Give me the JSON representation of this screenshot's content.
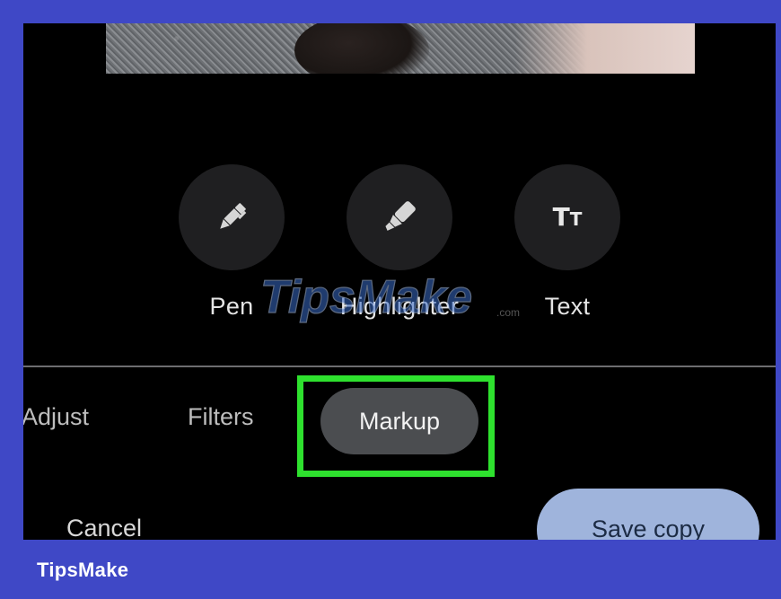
{
  "tools": [
    {
      "label": "Pen",
      "icon": "pen-icon"
    },
    {
      "label": "Highlighter",
      "icon": "highlighter-icon"
    },
    {
      "label": "Text",
      "icon": "text-icon",
      "glyph_big": "T",
      "glyph_small": "T"
    }
  ],
  "tabs": {
    "adjust": "Adjust",
    "filters": "Filters",
    "markup": "Markup",
    "selected": "Markup"
  },
  "actions": {
    "cancel": "Cancel",
    "save": "Save copy"
  },
  "watermark": {
    "text": "TipsMake",
    "suffix": ".com"
  },
  "footer": {
    "brand": "TipsMake"
  },
  "colors": {
    "frame": "#3f48c6",
    "highlight": "#2ee12e",
    "save_button": "#9fb4dc",
    "selected_tab": "#4b4d50"
  }
}
